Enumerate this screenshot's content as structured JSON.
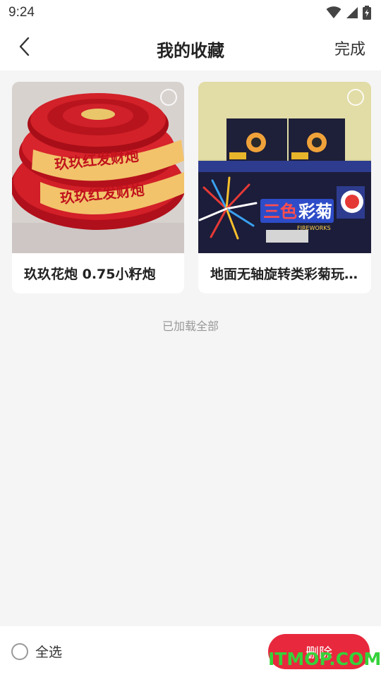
{
  "status_bar": {
    "time": "9:24",
    "icons": [
      "wifi-icon",
      "signal-icon",
      "battery-charging-icon"
    ]
  },
  "nav": {
    "back_icon": "chevron-left-icon",
    "title": "我的收藏",
    "done_label": "完成"
  },
  "favorites": [
    {
      "title": "玖玖花炮 0.75小籽炮",
      "image_text": [
        "玖玖红发财炮",
        "玖玖红发财炮"
      ],
      "selected": false
    },
    {
      "title": "地面无轴旋转类彩菊玩具烟花",
      "image_text": [
        "三色",
        "彩菊",
        "FIREWORKS"
      ],
      "selected": false
    }
  ],
  "load_status": "已加载全部",
  "bottom": {
    "select_all_label": "全选",
    "delete_label": "删除"
  },
  "watermark": "ITMOP.COM",
  "colors": {
    "accent": "#e8283d",
    "background": "#f5f5f5",
    "watermark": "#35d23a"
  }
}
